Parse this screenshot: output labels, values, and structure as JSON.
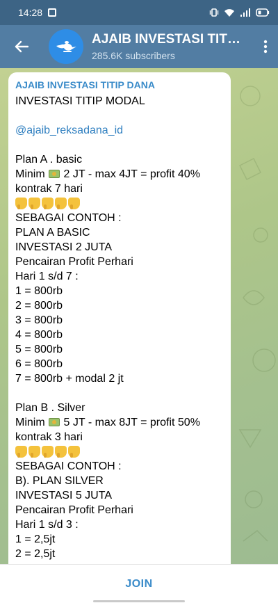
{
  "status_bar": {
    "time": "14:28"
  },
  "header": {
    "title": "AJAIB INVESTASI TITI…",
    "subscribers": "285.6K subscribers",
    "accent": "#527da3"
  },
  "message": {
    "sender": "AJAIB INVESTASI TITIP DANA",
    "lines": [
      "INVESTASI TITIP MODAL",
      "",
      "@ajaib_reksadana_id",
      "",
      "Plan A . basic",
      "Minim 💵 2 JT - max 4JT = profit 40%",
      "kontrak 7 hari",
      "👇👇👇👇👇",
      "SEBAGAI CONTOH :",
      "PLAN A BASIC",
      "INVESTASI 2 JUTA",
      "Pencairan Profit Perhari",
      "Hari 1 s/d 7 :",
      "1 = 800rb",
      "2 = 800rb",
      "3 = 800rb",
      "4 = 800rb",
      "5 = 800rb",
      "6 = 800rb",
      "7 = 800rb + modal 2 jt",
      "",
      "Plan B . Silver",
      "Minim 💵 5 JT - max 8JT = profit 50%",
      "kontrak 3 hari",
      "👇👇👇👇👇",
      "SEBAGAI CONTOH :",
      "B). PLAN SILVER",
      "INVESTASI 5 JUTA",
      "Pencairan Profit Perhari",
      "Hari 1 s/d 3 :",
      "1 = 2,5jt",
      "2 = 2,5jt"
    ]
  },
  "join": {
    "label": "JOIN"
  }
}
